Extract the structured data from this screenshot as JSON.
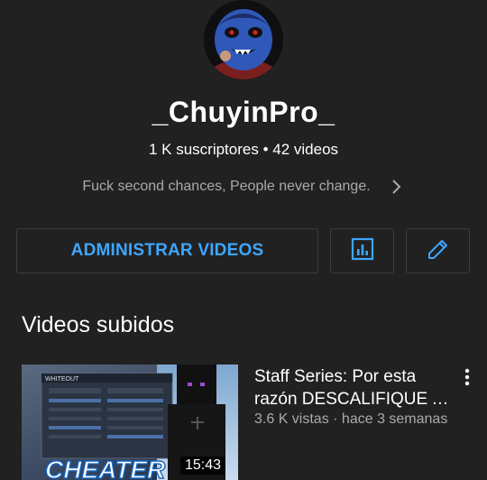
{
  "channel": {
    "name": "_ChuyinPro_",
    "stats": "1 K suscriptores • 42 videos",
    "description": "Fuck second chances, People never change."
  },
  "actions": {
    "manage_videos_label": "ADMINISTRAR VIDEOS",
    "analytics_icon": "bar-chart-icon",
    "edit_icon": "pencil-icon"
  },
  "uploads": {
    "section_title": "Videos subidos",
    "videos": [
      {
        "title": "Staff Series: Por esta razón DESCALIFIQUE A ...",
        "meta": "3.6 K vistas · hace 3 semanas",
        "duration": "15:43",
        "thumbnail_texts": [
          "WHITEOUT",
          "CHEATER"
        ]
      }
    ]
  },
  "colors": {
    "background": "#212121",
    "accent": "#3ea6ff",
    "secondary_text": "#aaaaaa",
    "border": "#3d3d3d"
  }
}
